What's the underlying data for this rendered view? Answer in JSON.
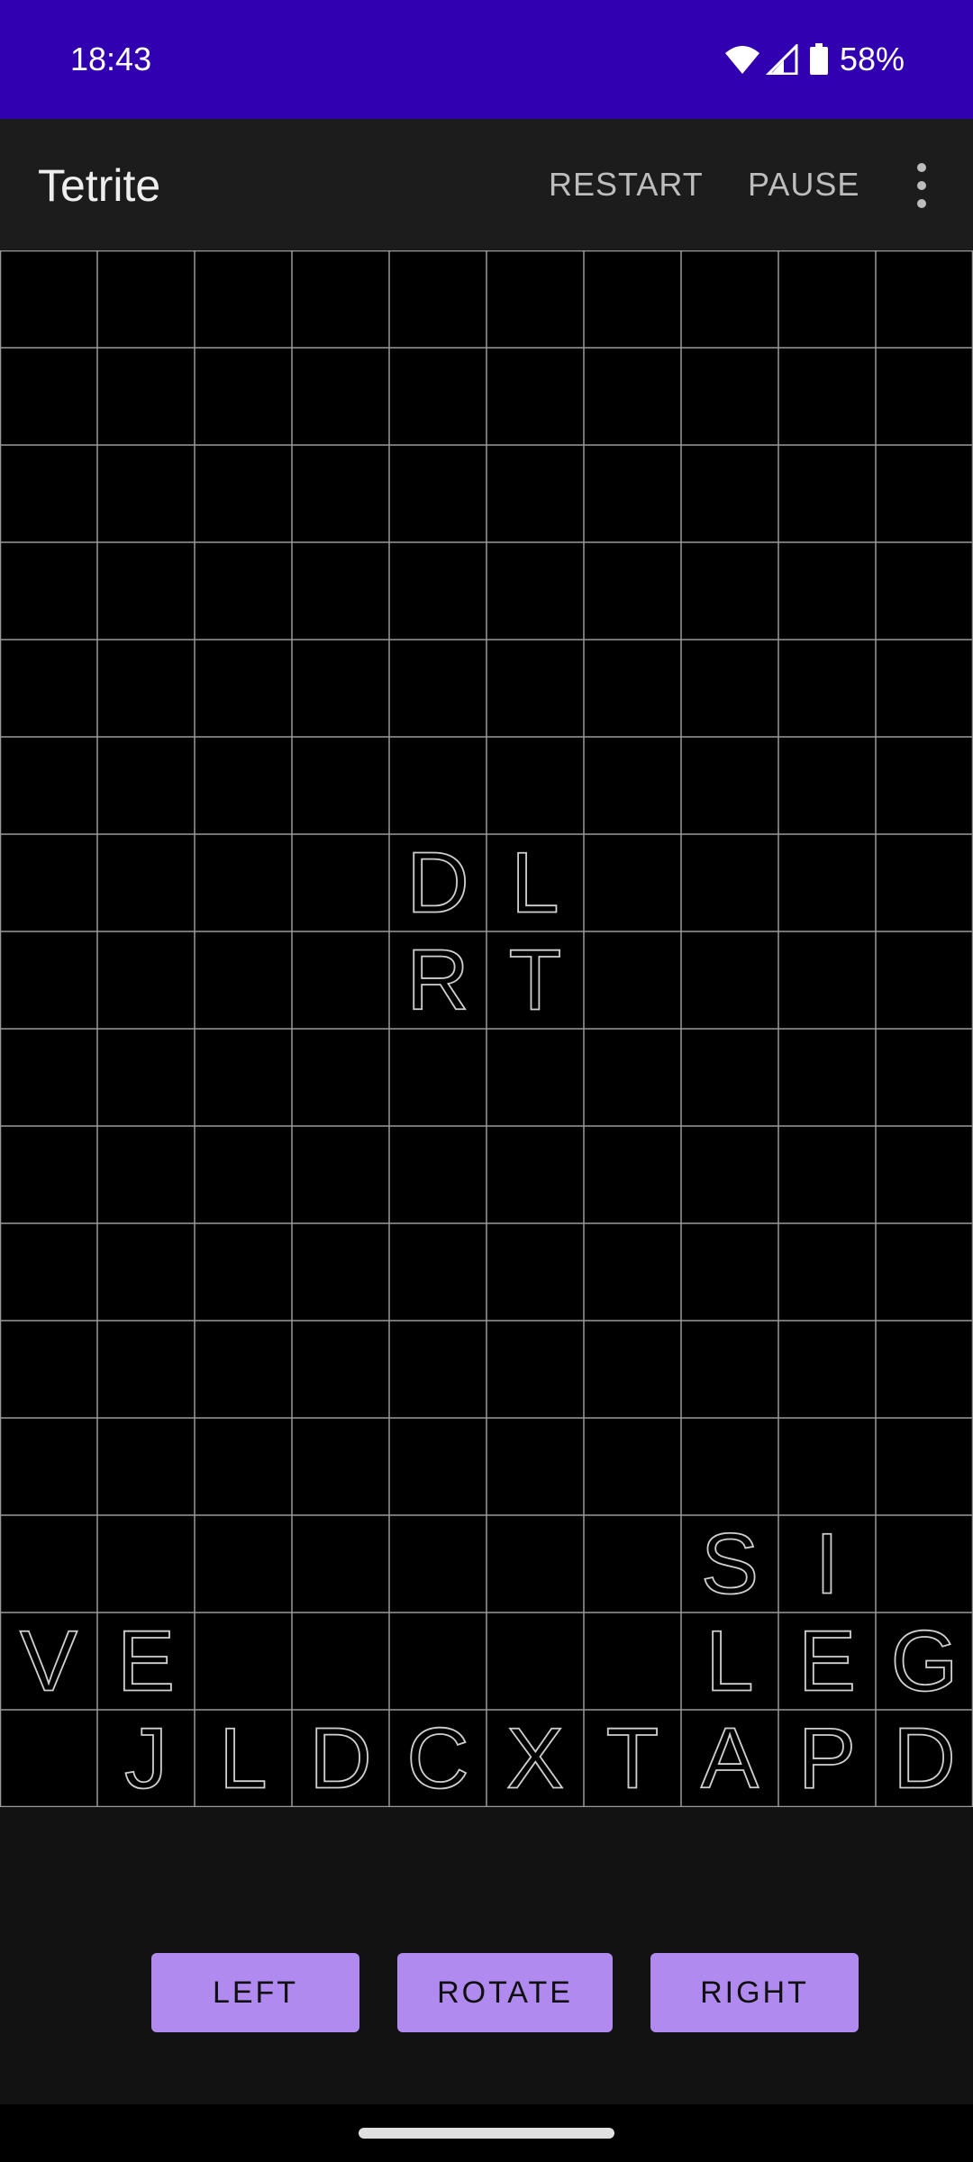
{
  "status_bar": {
    "time": "18:43",
    "battery_percent": "58%",
    "icons": [
      "wifi-icon",
      "cellular-signal-icon",
      "battery-icon"
    ]
  },
  "app_bar": {
    "title": "Tetrite",
    "actions": {
      "restart": "RESTART",
      "pause": "PAUSE"
    },
    "overflow_icon": "more-vert-icon"
  },
  "board": {
    "columns": 10,
    "rows": 16,
    "cell_letters": [
      {
        "row": 6,
        "col": 4,
        "letter": "D"
      },
      {
        "row": 6,
        "col": 5,
        "letter": "L"
      },
      {
        "row": 7,
        "col": 4,
        "letter": "R"
      },
      {
        "row": 7,
        "col": 5,
        "letter": "T"
      },
      {
        "row": 13,
        "col": 7,
        "letter": "S"
      },
      {
        "row": 13,
        "col": 8,
        "letter": "I"
      },
      {
        "row": 14,
        "col": 0,
        "letter": "V"
      },
      {
        "row": 14,
        "col": 1,
        "letter": "E"
      },
      {
        "row": 14,
        "col": 7,
        "letter": "L"
      },
      {
        "row": 14,
        "col": 8,
        "letter": "E"
      },
      {
        "row": 14,
        "col": 9,
        "letter": "G"
      },
      {
        "row": 15,
        "col": 1,
        "letter": "J"
      },
      {
        "row": 15,
        "col": 2,
        "letter": "L"
      },
      {
        "row": 15,
        "col": 3,
        "letter": "D"
      },
      {
        "row": 15,
        "col": 4,
        "letter": "C"
      },
      {
        "row": 15,
        "col": 5,
        "letter": "X"
      },
      {
        "row": 15,
        "col": 6,
        "letter": "T"
      },
      {
        "row": 15,
        "col": 7,
        "letter": "A"
      },
      {
        "row": 15,
        "col": 8,
        "letter": "P"
      },
      {
        "row": 15,
        "col": 9,
        "letter": "D"
      }
    ],
    "colors": {
      "background": "#000000",
      "grid_line": "#9a9a9a",
      "letter_outline": "#cfcfcf"
    }
  },
  "controls": {
    "left": "LEFT",
    "rotate": "ROTATE",
    "right": "RIGHT",
    "button_color": "#b18af0"
  },
  "colors": {
    "status_bar": "#3100b0",
    "app_bar": "#1c1c1c",
    "screen_bg": "#121212"
  }
}
